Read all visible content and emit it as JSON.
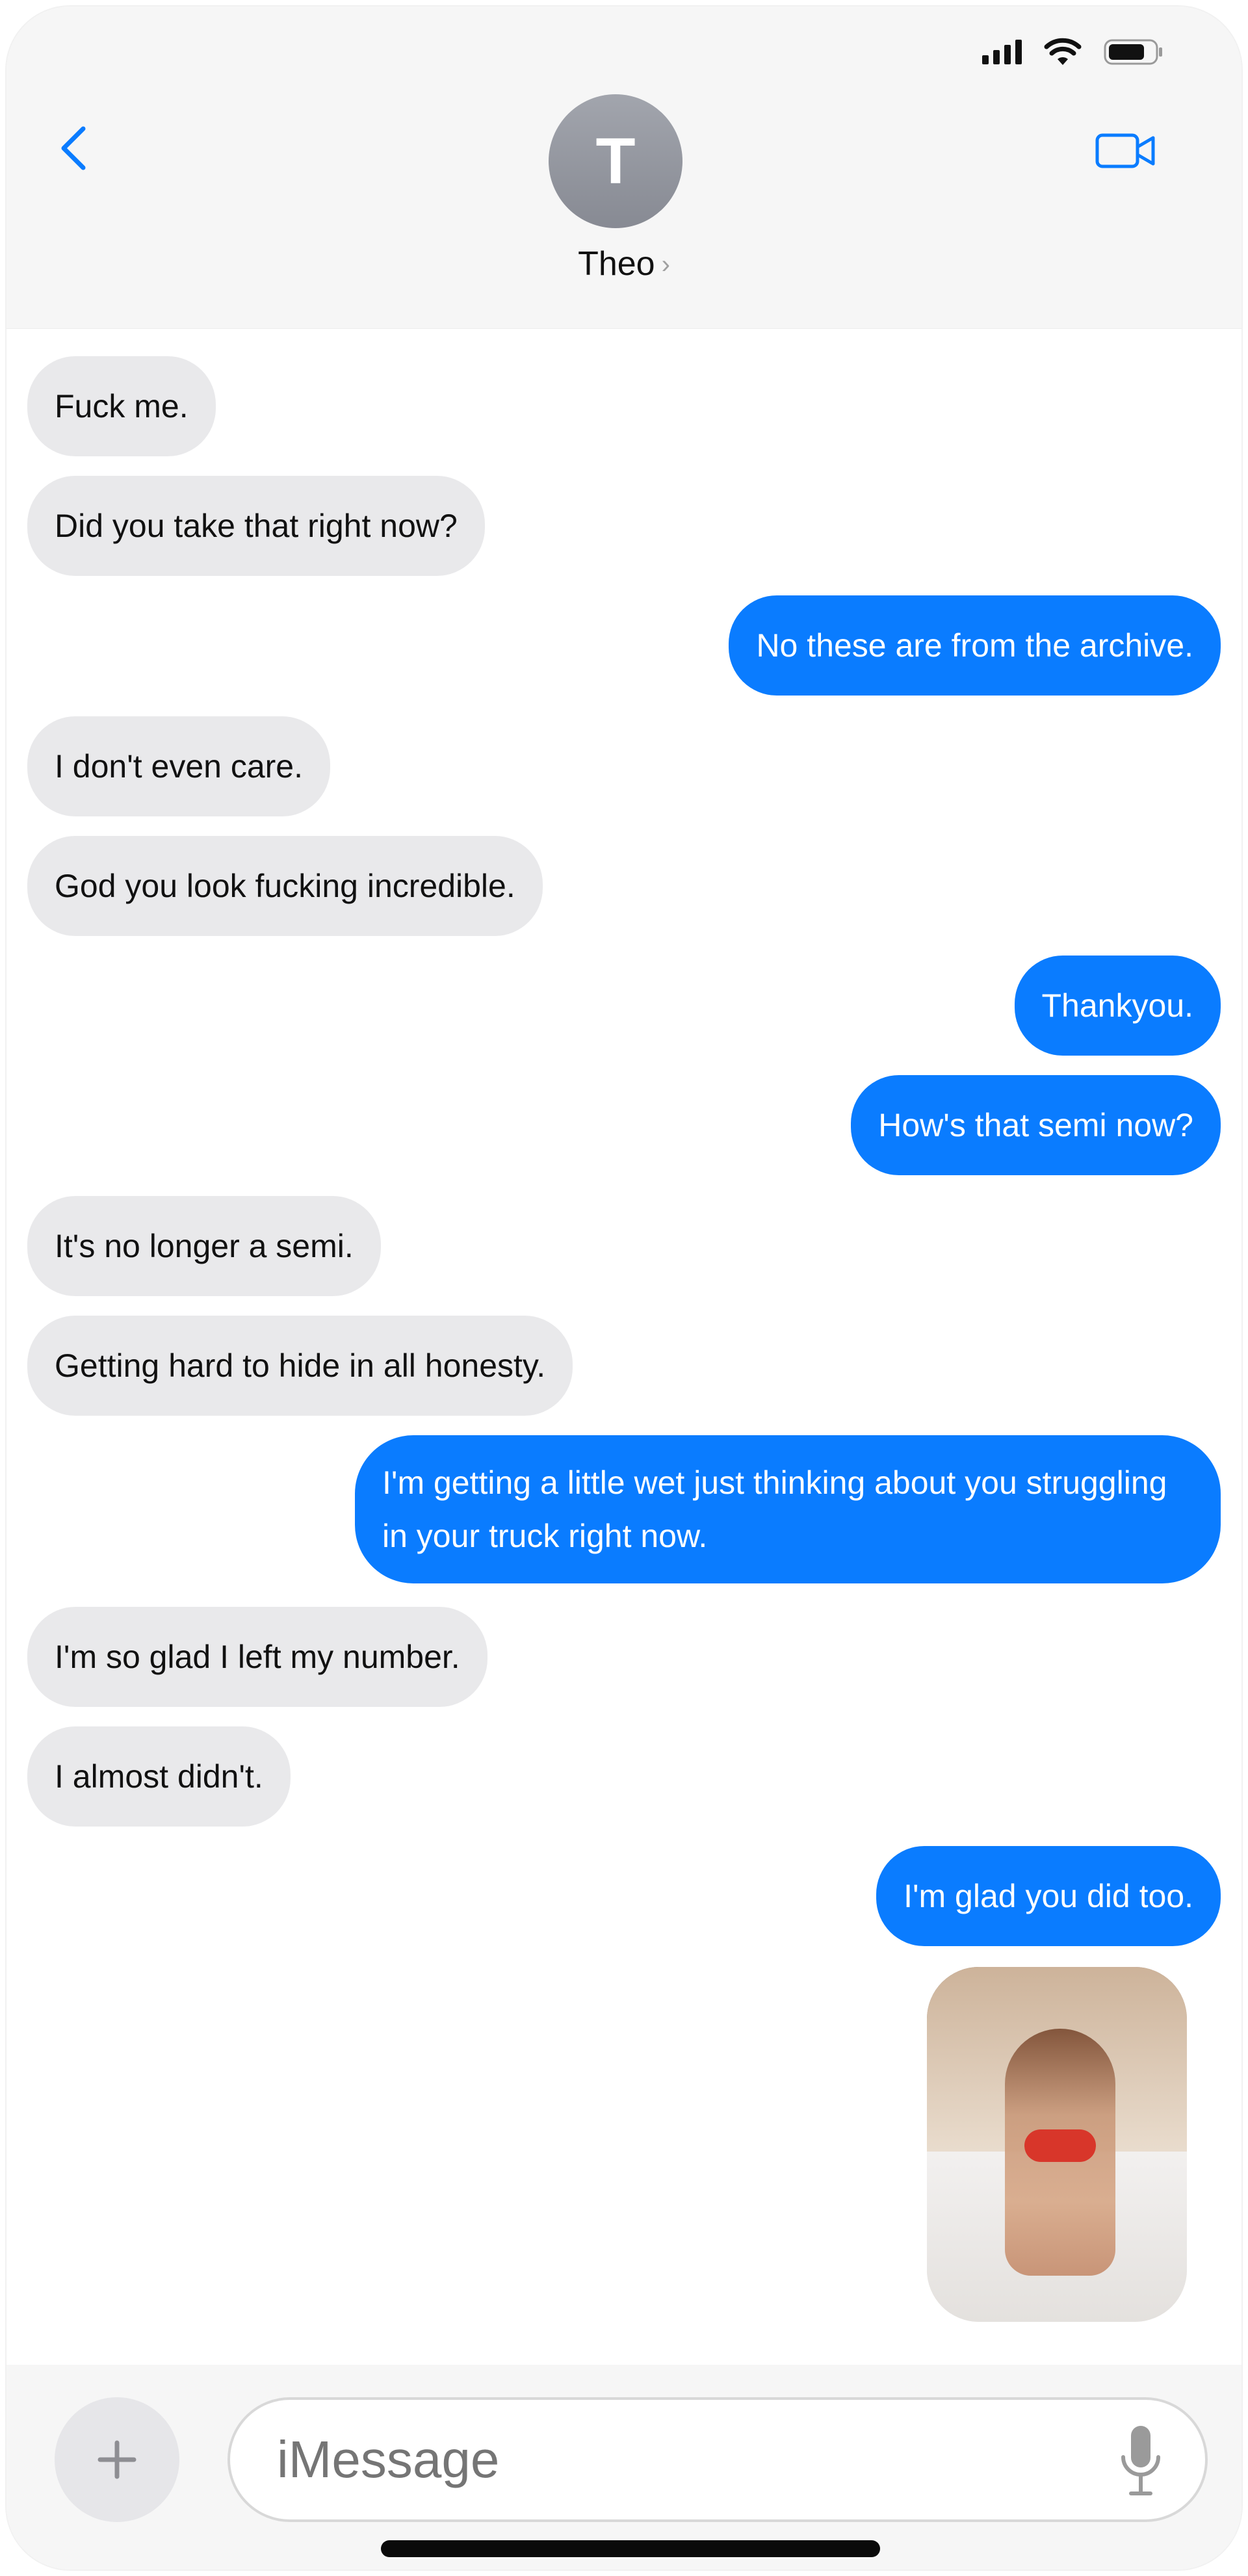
{
  "contact": {
    "initial": "T",
    "name": "Theo",
    "chevron": "›"
  },
  "status_icons": [
    "signal-icon",
    "wifi-icon",
    "battery-icon"
  ],
  "colors": {
    "incoming_bubble": "#e9e9eb",
    "outgoing_bubble": "#0a7cff",
    "accent": "#0a7cff"
  },
  "messages": [
    {
      "dir": "in",
      "text": "Fuck me."
    },
    {
      "dir": "in",
      "text": "Did you take that right now?"
    },
    {
      "dir": "out",
      "text": "No these are from the archive."
    },
    {
      "dir": "in",
      "text": "I don't even care."
    },
    {
      "dir": "in",
      "text": "God you look fucking incredible."
    },
    {
      "dir": "out",
      "text": "Thankyou."
    },
    {
      "dir": "out",
      "text": "How's that semi now?"
    },
    {
      "dir": "in",
      "text": "It's no longer a semi."
    },
    {
      "dir": "in",
      "text": "Getting hard to hide in all honesty."
    },
    {
      "dir": "out",
      "text": "I'm getting a little wet just thinking about you struggling in your truck right now."
    },
    {
      "dir": "in",
      "text": "I'm so glad I left my number."
    },
    {
      "dir": "in",
      "text": "I almost didn't."
    },
    {
      "dir": "out",
      "text": "I'm glad you did too."
    }
  ],
  "attachment": {
    "type": "photo"
  },
  "composer": {
    "placeholder": "iMessage"
  }
}
